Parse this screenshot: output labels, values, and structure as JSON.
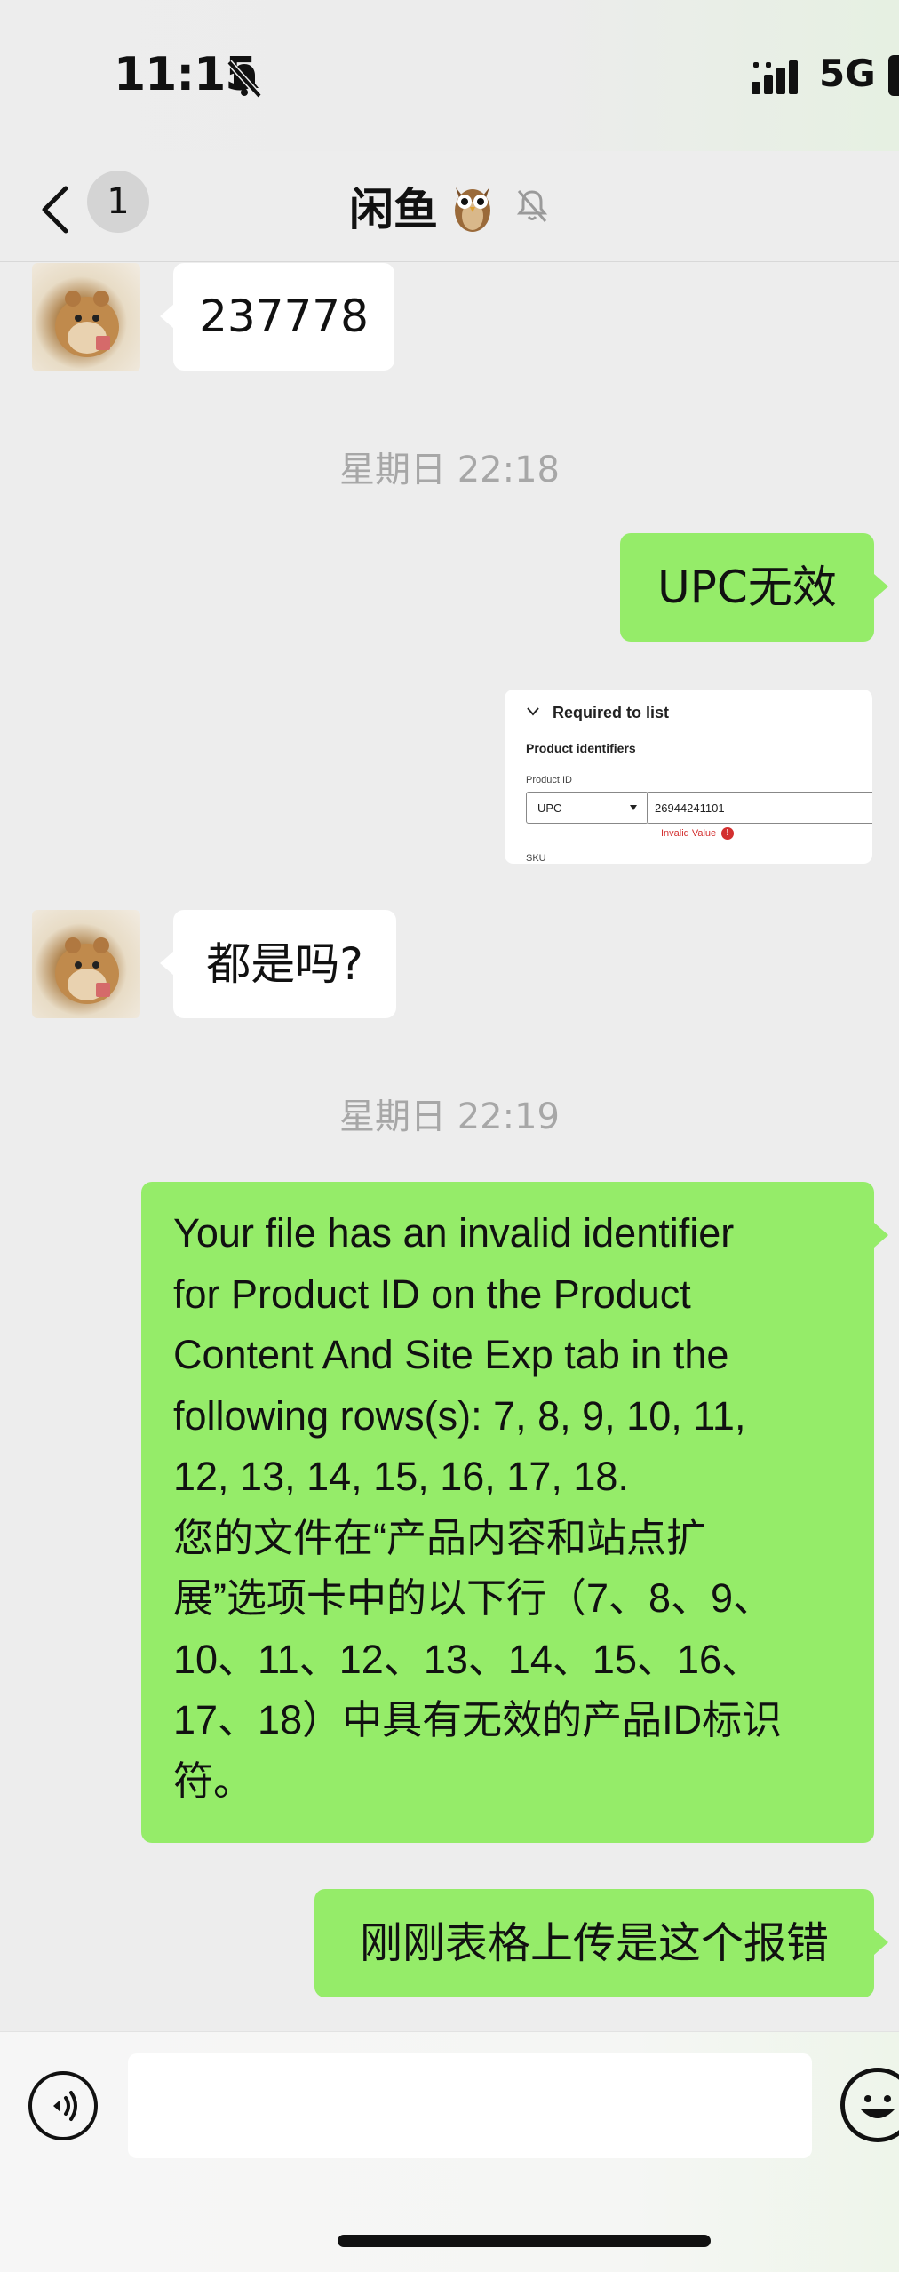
{
  "status_bar": {
    "time": "11:15",
    "network": "5G"
  },
  "nav": {
    "unread_count": "1",
    "title": "闲鱼"
  },
  "messages": {
    "m1_text": "237778",
    "ts1": "星期日 22:18",
    "m2_text": "UPC无效",
    "image": {
      "section": "Required to list",
      "group": "Product identifiers",
      "field_label": "Product ID",
      "select_value": "UPC",
      "input_value": "26944241101",
      "error": "Invalid Value",
      "sku": "SKU"
    },
    "m3_text": "都是吗?",
    "ts2": "星期日 22:19",
    "m4_lines": [
      "Your file has an invalid identifier",
      "for Product ID on the Product",
      "Content And Site Exp tab in the",
      "following rows(s): 7, 8, 9, 10, 11,",
      "12, 13, 14, 15, 16, 17, 18.",
      "您的文件在“产品内容和站点扩",
      "展”选项卡中的以下行（7、8、9、",
      "10、11、12、13、14、15、16、",
      "17、18）中具有无效的产品ID标识",
      "符。"
    ],
    "m5_text": "刚刚表格上传是这个报错"
  },
  "input": {
    "placeholder": ""
  },
  "colors": {
    "sent_bubble": "#95ec69",
    "received_bubble": "#ffffff",
    "background": "#ededed"
  }
}
